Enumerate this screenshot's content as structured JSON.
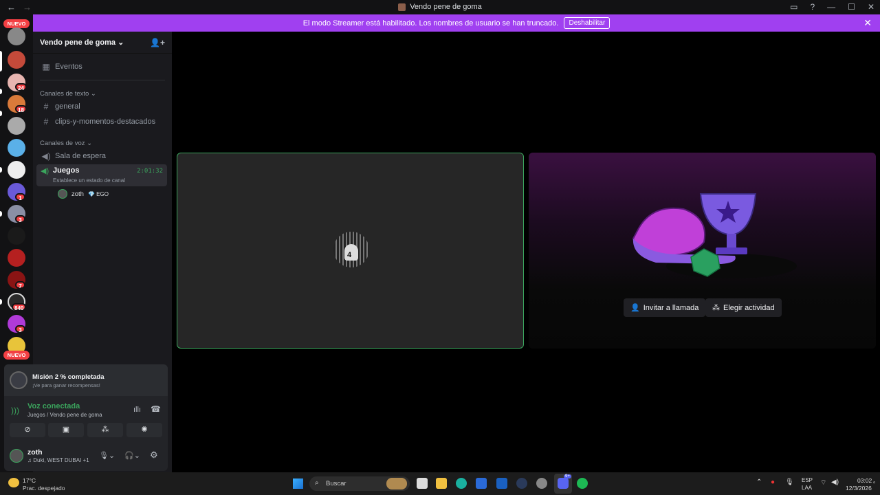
{
  "window": {
    "title": "Vendo pene de goma",
    "back": "←",
    "forward": "→",
    "min": "—",
    "max": "☐",
    "close": "✕"
  },
  "banner": {
    "text": "El modo Streamer está habilitado. Los nombres de usuario se han truncado.",
    "button": "Deshabilitar",
    "close": "✕"
  },
  "servers": {
    "nuevo_top": "NUEVO",
    "nuevo_bottom": "NUEVO",
    "badges": [
      "24",
      "18",
      "1",
      "3",
      "7",
      "840",
      "3"
    ]
  },
  "sidebar": {
    "server_name": "Vendo pene de goma",
    "events": "Eventos",
    "text_category": "Canales de texto",
    "text_channels": [
      "general",
      "clips-y-momentos-destacados"
    ],
    "voice_category": "Canales de voz",
    "voice_channels": [
      "Sala de espera",
      "Juegos"
    ],
    "active_timer": "2:01:32",
    "status_hint": "Establece un estado de canal",
    "voice_user": "zoth",
    "voice_user_tag": "EGO"
  },
  "call": {
    "avatar_number": "4",
    "invite_button": "Invitar a llamada",
    "activity_button": "Elegir actividad"
  },
  "mission": {
    "title": "Misión 2 % completada",
    "subtitle": "¡Ve para ganar recompensas!"
  },
  "voice": {
    "status": "Voz conectada",
    "location": "Juegos / Vendo pene de goma"
  },
  "user": {
    "name": "zoth",
    "activity": "Duki, WEST DUBAI +1"
  },
  "taskbar": {
    "weather_temp": "17°C",
    "weather_desc": "Prac. despejado",
    "search": "Buscar",
    "lang1": "ESP",
    "lang2": "LAA",
    "time": "03:02",
    "date": "12/3/2026",
    "discord_badge": "9+"
  },
  "colors": {
    "accent": "#a040f0",
    "green": "#3ba55d",
    "red": "#f23f43"
  }
}
